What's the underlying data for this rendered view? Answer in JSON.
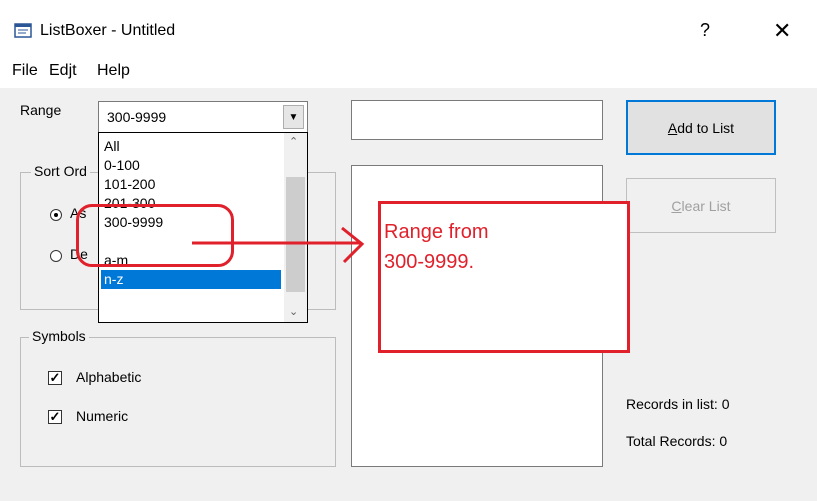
{
  "window": {
    "title": "ListBoxer - Untitled",
    "help_glyph": "?",
    "close_glyph": "✕"
  },
  "menu": [
    "File",
    "Edjt",
    "Help"
  ],
  "range": {
    "label": "Range",
    "value": "300-9999",
    "options": [
      "All",
      "0-100",
      "101-200",
      "201-300",
      "300-9999",
      "a-m",
      "n-z"
    ],
    "highlighted": "n-z"
  },
  "sort_order": {
    "title": "Sort Ord",
    "asc_partial": "As",
    "desc_partial": "De"
  },
  "symbols": {
    "title": "Symbols",
    "items": [
      {
        "label": "Alphabetic",
        "checked": true
      },
      {
        "label": "Numeric",
        "checked": true
      }
    ]
  },
  "entry": {
    "value": ""
  },
  "buttons": {
    "add_pre": "",
    "add_u": "A",
    "add_post": "dd to List",
    "clear_pre": "",
    "clear_u": "C",
    "clear_post": "lear List"
  },
  "stats": {
    "records_in_list": "Records in list: 0",
    "total_records": "Total Records: 0"
  },
  "annotation": {
    "line1": "Range from",
    "line2": "300-9999.",
    "color": "#e0202a"
  },
  "colors": {
    "selection": "#0078d7",
    "accent": "#0078d7"
  }
}
